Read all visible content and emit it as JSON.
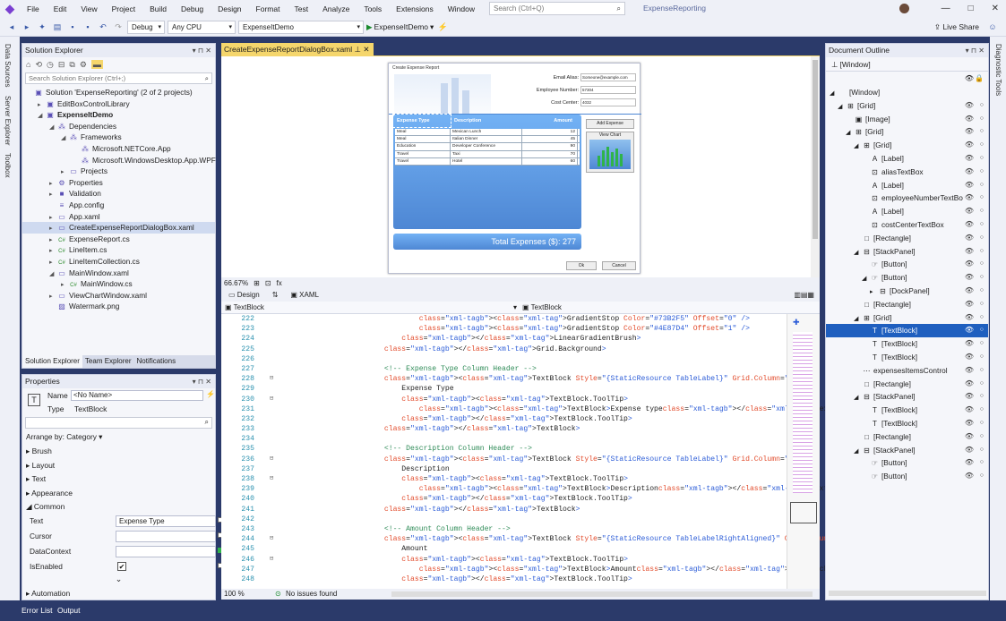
{
  "menu": [
    "File",
    "Edit",
    "View",
    "Project",
    "Build",
    "Debug",
    "Design",
    "Format",
    "Test",
    "Analyze",
    "Tools",
    "Extensions",
    "Window",
    "Help"
  ],
  "search": {
    "placeholder": "Search (Ctrl+Q)"
  },
  "solution_name": "ExpenseReporting",
  "toolbar": {
    "config": "Debug",
    "platform": "Any CPU",
    "startup": "ExpenseItDemo",
    "run": "ExpenseItDemo",
    "liveshare": "Live Share"
  },
  "left_rail": [
    "Data Sources",
    "Server Explorer",
    "Toolbox"
  ],
  "right_rail": [
    "Diagnostic Tools"
  ],
  "solution_explorer": {
    "title": "Solution Explorer",
    "search": "Search Solution Explorer (Ctrl+;)",
    "items": [
      {
        "label": "Solution 'ExpenseReporting' (2 of 2 projects)",
        "indent": 0,
        "arrow": "",
        "icon": "▣"
      },
      {
        "label": "EditBoxControlLibrary",
        "indent": 1,
        "arrow": "▸",
        "icon": "▣"
      },
      {
        "label": "ExpenseItDemo",
        "indent": 1,
        "arrow": "◢",
        "icon": "▣",
        "bold": true
      },
      {
        "label": "Dependencies",
        "indent": 2,
        "arrow": "◢",
        "icon": "⁂"
      },
      {
        "label": "Frameworks",
        "indent": 3,
        "arrow": "◢",
        "icon": "⁂"
      },
      {
        "label": "Microsoft.NETCore.App",
        "indent": 4,
        "arrow": "",
        "icon": "⁂"
      },
      {
        "label": "Microsoft.WindowsDesktop.App.WPF",
        "indent": 4,
        "arrow": "",
        "icon": "⁂"
      },
      {
        "label": "Projects",
        "indent": 3,
        "arrow": "▸",
        "icon": "▭"
      },
      {
        "label": "Properties",
        "indent": 2,
        "arrow": "▸",
        "icon": "⚙"
      },
      {
        "label": "Validation",
        "indent": 2,
        "arrow": "▸",
        "icon": "■"
      },
      {
        "label": "App.config",
        "indent": 2,
        "arrow": "",
        "icon": "≡"
      },
      {
        "label": "App.xaml",
        "indent": 2,
        "arrow": "▸",
        "icon": "▭"
      },
      {
        "label": "CreateExpenseReportDialogBox.xaml",
        "indent": 2,
        "arrow": "▸",
        "icon": "▭",
        "selected": true
      },
      {
        "label": "ExpenseReport.cs",
        "indent": 2,
        "arrow": "▸",
        "icon": "C#"
      },
      {
        "label": "LineItem.cs",
        "indent": 2,
        "arrow": "▸",
        "icon": "C#"
      },
      {
        "label": "LineItemCollection.cs",
        "indent": 2,
        "arrow": "▸",
        "icon": "C#"
      },
      {
        "label": "MainWindow.xaml",
        "indent": 2,
        "arrow": "◢",
        "icon": "▭"
      },
      {
        "label": "MainWindow.cs",
        "indent": 3,
        "arrow": "▸",
        "icon": "C#"
      },
      {
        "label": "ViewChartWindow.xaml",
        "indent": 2,
        "arrow": "▸",
        "icon": "▭"
      },
      {
        "label": "Watermark.png",
        "indent": 2,
        "arrow": "",
        "icon": "▨"
      }
    ],
    "bottom_tabs": [
      "Solution Explorer",
      "Team Explorer",
      "Notifications"
    ]
  },
  "properties": {
    "title": "Properties",
    "name_label": "Name",
    "name_value": "<No Name>",
    "type_label": "Type",
    "type_value": "TextBlock",
    "arrange": "Arrange by: Category",
    "categories": [
      "Brush",
      "Layout",
      "Text",
      "Appearance"
    ],
    "common": "Common",
    "rows": [
      {
        "label": "Text",
        "value": "Expense Type"
      },
      {
        "label": "Cursor",
        "value": ""
      },
      {
        "label": "DataContext",
        "value": ""
      },
      {
        "label": "IsEnabled",
        "value": "✔"
      }
    ],
    "automation": "Automation"
  },
  "editor": {
    "tab": "CreateExpenseReportDialogBox.xaml",
    "zoom": "66.67%",
    "design_tab": "Design",
    "xaml_tab": "XAML",
    "breadcrumb_left": "TextBlock",
    "breadcrumb_right": "TextBlock",
    "code_zoom": "100 %",
    "issues": "No issues found",
    "dialog": {
      "title": "Create Expense Report",
      "email_label": "Email Alias:",
      "email_value": "Someone@example.com",
      "emp_label": "Employee Number:",
      "emp_value": "57304",
      "cost_label": "Cost Center:",
      "cost_value": "4032",
      "headers": [
        "Expense Type",
        "Description",
        "Amount"
      ],
      "rows": [
        [
          "Meal",
          "Mexican Lunch",
          "12"
        ],
        [
          "Meal",
          "Italian Dinner",
          "45"
        ],
        [
          "Education",
          "Developer Conference",
          "90"
        ],
        [
          "Travel",
          "Taxi",
          "70"
        ],
        [
          "Travel",
          "Hotel",
          "60"
        ]
      ],
      "add_button": "Add Expense",
      "chart_button": "View Chart",
      "total_label": "Total Expenses ($):",
      "total_value": "277",
      "ok": "Ok",
      "cancel": "Cancel"
    },
    "lines": [
      {
        "n": "222",
        "t": "                <GradientStop Color=\"#73B2F5\" Offset=\"0\" />"
      },
      {
        "n": "223",
        "t": "                <GradientStop Color=\"#4E87D4\" Offset=\"1\" />"
      },
      {
        "n": "224",
        "t": "            </LinearGradientBrush>"
      },
      {
        "n": "225",
        "t": "        </Grid.Background>"
      },
      {
        "n": "226",
        "t": ""
      },
      {
        "n": "227",
        "t": "        <!-- Expense Type Column Header -->"
      },
      {
        "n": "228",
        "t": "        <TextBlock Style=\"{StaticResource TableLabel}\" Grid.Column=\"0\">"
      },
      {
        "n": "229",
        "t": "            Expense Type"
      },
      {
        "n": "230",
        "t": "            <TextBlock.ToolTip>"
      },
      {
        "n": "231",
        "t": "                <TextBlock>Expense type</TextBlock>"
      },
      {
        "n": "232",
        "t": "            </TextBlock.ToolTip>"
      },
      {
        "n": "233",
        "t": "        </TextBlock>"
      },
      {
        "n": "234",
        "t": ""
      },
      {
        "n": "235",
        "t": "        <!-- Description Column Header -->"
      },
      {
        "n": "236",
        "t": "        <TextBlock Style=\"{StaticResource TableLabel}\" Grid.Column=\"1\">"
      },
      {
        "n": "237",
        "t": "            Description"
      },
      {
        "n": "238",
        "t": "            <TextBlock.ToolTip>"
      },
      {
        "n": "239",
        "t": "                <TextBlock>Description</TextBlock>"
      },
      {
        "n": "240",
        "t": "            </TextBlock.ToolTip>"
      },
      {
        "n": "241",
        "t": "        </TextBlock>"
      },
      {
        "n": "242",
        "t": ""
      },
      {
        "n": "243",
        "t": "        <!-- Amount Column Header -->"
      },
      {
        "n": "244",
        "t": "        <TextBlock Style=\"{StaticResource TableLabelRightAligned}\" Grid.Column=\"2\">"
      },
      {
        "n": "245",
        "t": "            Amount"
      },
      {
        "n": "246",
        "t": "            <TextBlock.ToolTip>"
      },
      {
        "n": "247",
        "t": "                <TextBlock>Amount</TextBlock>"
      },
      {
        "n": "248",
        "t": "            </TextBlock.ToolTip>"
      }
    ]
  },
  "outline": {
    "title": "Document Outline",
    "window_crumb": "[Window]",
    "items": [
      {
        "label": "[Window]",
        "indent": 0,
        "arrow": "◢",
        "icon": ""
      },
      {
        "label": "[Grid]",
        "indent": 1,
        "arrow": "◢",
        "icon": "⊞"
      },
      {
        "label": "[Image]",
        "indent": 2,
        "arrow": "",
        "icon": "▣"
      },
      {
        "label": "[Grid]",
        "indent": 2,
        "arrow": "◢",
        "icon": "⊞"
      },
      {
        "label": "[Grid]",
        "indent": 3,
        "arrow": "◢",
        "icon": "⊞"
      },
      {
        "label": "[Label]",
        "indent": 4,
        "arrow": "",
        "icon": "A"
      },
      {
        "label": "aliasTextBox",
        "indent": 4,
        "arrow": "",
        "icon": "⊡"
      },
      {
        "label": "[Label]",
        "indent": 4,
        "arrow": "",
        "icon": "A"
      },
      {
        "label": "employeeNumberTextBo",
        "indent": 4,
        "arrow": "",
        "icon": "⊡"
      },
      {
        "label": "[Label]",
        "indent": 4,
        "arrow": "",
        "icon": "A"
      },
      {
        "label": "costCenterTextBox",
        "indent": 4,
        "arrow": "",
        "icon": "⊡"
      },
      {
        "label": "[Rectangle]",
        "indent": 3,
        "arrow": "",
        "icon": "□"
      },
      {
        "label": "[StackPanel]",
        "indent": 3,
        "arrow": "◢",
        "icon": "⊟"
      },
      {
        "label": "[Button]",
        "indent": 4,
        "arrow": "",
        "icon": "☞"
      },
      {
        "label": "[Button]",
        "indent": 4,
        "arrow": "◢",
        "icon": "☞"
      },
      {
        "label": "[DockPanel]",
        "indent": 5,
        "arrow": "▸",
        "icon": "⊟"
      },
      {
        "label": "[Rectangle]",
        "indent": 3,
        "arrow": "",
        "icon": "□"
      },
      {
        "label": "[Grid]",
        "indent": 3,
        "arrow": "◢",
        "icon": "⊞"
      },
      {
        "label": "[TextBlock]",
        "indent": 4,
        "arrow": "",
        "icon": "T",
        "selected": true
      },
      {
        "label": "[TextBlock]",
        "indent": 4,
        "arrow": "",
        "icon": "T"
      },
      {
        "label": "[TextBlock]",
        "indent": 4,
        "arrow": "",
        "icon": "T"
      },
      {
        "label": "expensesItemsControl",
        "indent": 3,
        "arrow": "",
        "icon": "⋯"
      },
      {
        "label": "[Rectangle]",
        "indent": 3,
        "arrow": "",
        "icon": "□"
      },
      {
        "label": "[StackPanel]",
        "indent": 3,
        "arrow": "◢",
        "icon": "⊟"
      },
      {
        "label": "[TextBlock]",
        "indent": 4,
        "arrow": "",
        "icon": "T"
      },
      {
        "label": "[TextBlock]",
        "indent": 4,
        "arrow": "",
        "icon": "T"
      },
      {
        "label": "[Rectangle]",
        "indent": 3,
        "arrow": "",
        "icon": "□"
      },
      {
        "label": "[StackPanel]",
        "indent": 3,
        "arrow": "◢",
        "icon": "⊟"
      },
      {
        "label": "[Button]",
        "indent": 4,
        "arrow": "",
        "icon": "☞"
      },
      {
        "label": "[Button]",
        "indent": 4,
        "arrow": "",
        "icon": "☞"
      }
    ]
  },
  "status_tabs": [
    "Error List",
    "Output"
  ],
  "colors": {
    "accent": "#1f5fbf",
    "tab_active": "#f5d66c",
    "frame": "#2b3a6a",
    "grid_blue": "#4e87d4"
  }
}
